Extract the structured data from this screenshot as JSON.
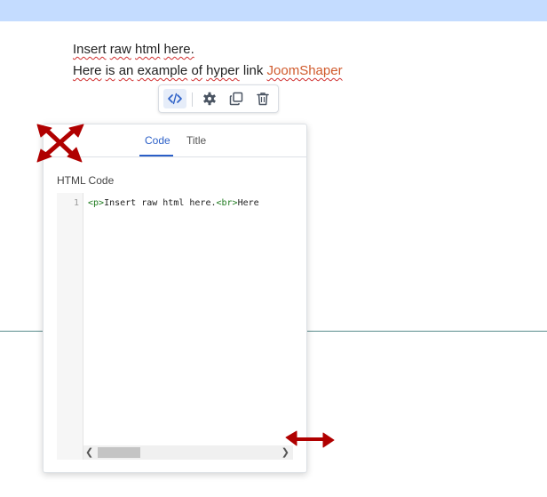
{
  "content": {
    "line1": {
      "w1": "Insert",
      "w2": "raw",
      "w3": "html",
      "w4": "here."
    },
    "line2": {
      "w1": "Here",
      "w2": "is",
      "w3": "an",
      "w4": "example",
      "w5": "of",
      "w6": "hyper",
      "w7": "link",
      "link_text": "JoomShaper"
    }
  },
  "toolbar": {
    "icons": [
      "code-icon",
      "gear-icon",
      "duplicate-icon",
      "trash-icon"
    ]
  },
  "panel": {
    "tabs": [
      {
        "label": "Code",
        "active": true
      },
      {
        "label": "Title",
        "active": false
      }
    ],
    "field_label": "HTML Code",
    "editor": {
      "line_number": "1",
      "code": {
        "tag1": "<p>",
        "text1": "Insert raw html here.",
        "tag2": "<br>",
        "text2": "Here"
      }
    }
  },
  "colors": {
    "accent": "#2b5fc7",
    "link": "#d05a2c",
    "top_band": "#c4dcff",
    "resize_arrow": "#b00000",
    "code_tag": "#1d7a1d"
  }
}
